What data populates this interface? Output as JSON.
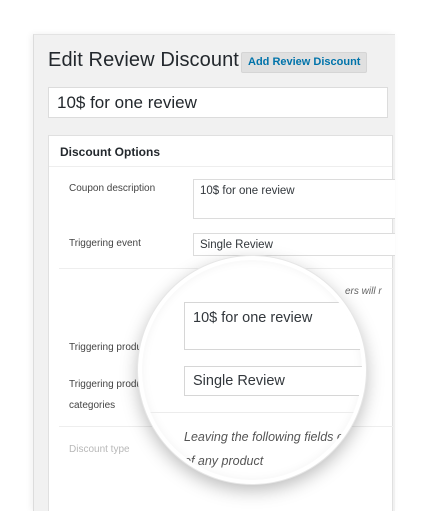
{
  "header": {
    "title": "Edit Review Discount",
    "add_button": "Add Review Discount"
  },
  "post_title": "10$ for one review",
  "discount_options": {
    "heading": "Discount Options",
    "coupon_description_label": "Coupon description",
    "coupon_description_value": "10$ for one review",
    "triggering_event_label": "Triggering event",
    "triggering_event_value": "Single Review",
    "partial_hint": "ers will r",
    "triggering_products_label": "Triggering produ",
    "triggering_categories_label_1": "Triggering produ",
    "triggering_categories_label_2": "categories",
    "discount_type_label": "Discount type"
  },
  "magnifier": {
    "description_value": "10$ for one review",
    "event_value": "Single Review",
    "hint_line_1": "Leaving the following fields empty",
    "hint_line_2": "of any product"
  }
}
